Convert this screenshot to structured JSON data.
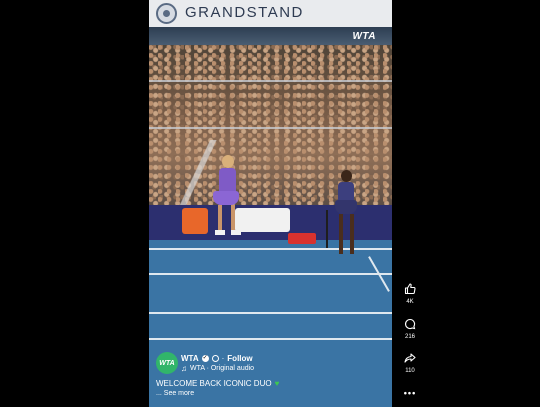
{
  "venue": {
    "banner_text": "GRANDSTAND"
  },
  "broadcast": {
    "watermark": "WTA"
  },
  "post": {
    "avatar_text": "WTA",
    "account_name": "WTA",
    "separator": "·",
    "follow_label": "Follow",
    "audio_label": "WTA · Original audio",
    "caption": "WELCOME BACK ICONIC DUO",
    "caption_emoji": "green-heart",
    "see_more_label": "... See more"
  },
  "actions": {
    "likes": "4K",
    "comments": "216",
    "shares": "110"
  },
  "icons": {
    "like": "thumbs-up-icon",
    "comment": "comment-icon",
    "share": "share-arrow-icon",
    "more": "more-dots-icon"
  },
  "colors": {
    "court": "#3a74a4",
    "avatar": "#31b56a",
    "player_outfit": "#7f5bc6",
    "heart": "#3ec94f"
  }
}
